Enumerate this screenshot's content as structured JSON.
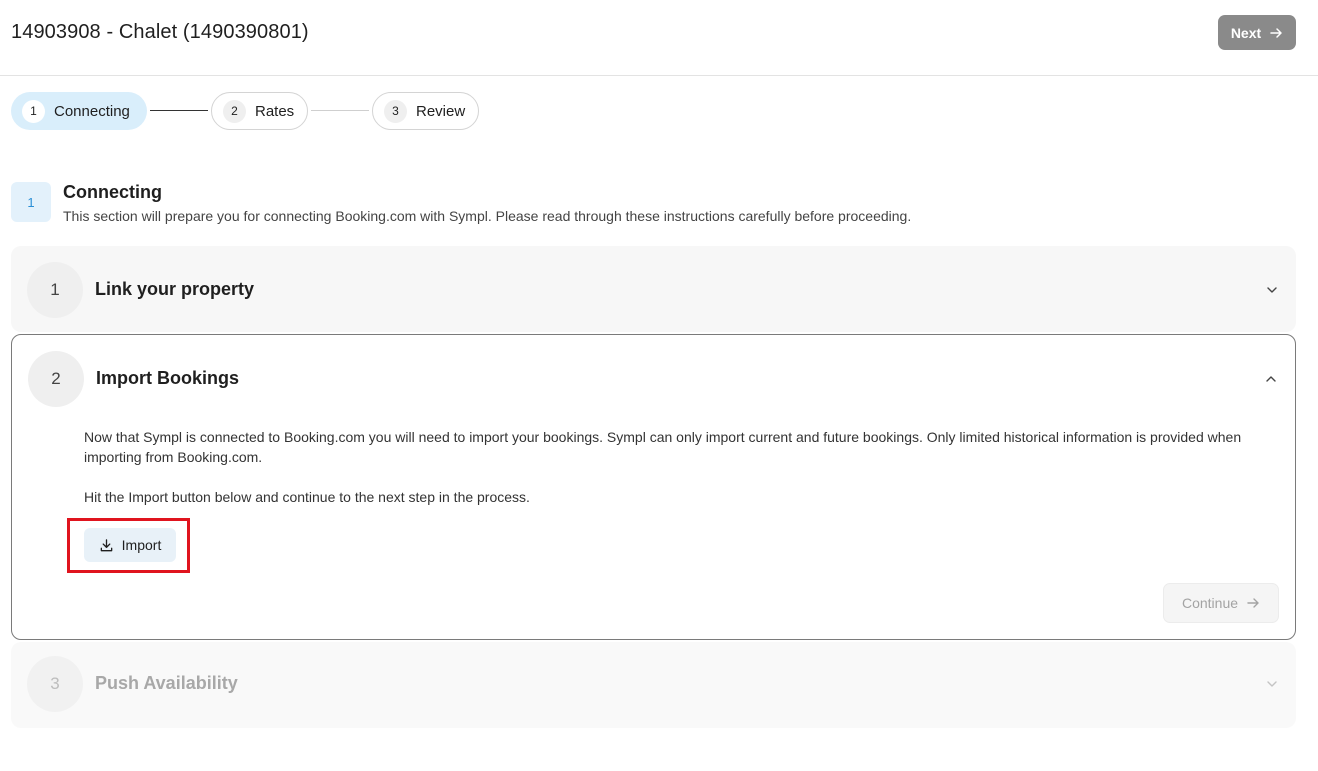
{
  "header": {
    "title": "14903908 - Chalet (1490390801)",
    "next_label": "Next"
  },
  "stepper": {
    "steps": [
      {
        "number": "1",
        "label": "Connecting"
      },
      {
        "number": "2",
        "label": "Rates"
      },
      {
        "number": "3",
        "label": "Review"
      }
    ]
  },
  "section": {
    "number": "1",
    "title": "Connecting",
    "description": "This section will prepare you for connecting Booking.com with Sympl. Please read through these instructions carefully before proceeding."
  },
  "accordion": [
    {
      "number": "1",
      "title": "Link your property"
    },
    {
      "number": "2",
      "title": "Import Bookings",
      "paragraph_1": "Now that Sympl is connected to Booking.com you will need to import your bookings. Sympl can only import current and future bookings. Only limited historical information is provided when importing from Booking.com.",
      "paragraph_2": "Hit the Import button below and continue to the next step in the process.",
      "import_label": "Import",
      "continue_label": "Continue"
    },
    {
      "number": "3",
      "title": "Push Availability"
    }
  ],
  "colors": {
    "active_step_bg": "#d9eefb",
    "highlight_border": "#e0141e",
    "next_button_bg": "#8a8a8a"
  },
  "icons": {
    "next": "arrow-right-icon",
    "import": "download-icon",
    "continue": "arrow-right-icon",
    "expand": "chevron-down-icon",
    "collapse": "chevron-up-icon"
  }
}
